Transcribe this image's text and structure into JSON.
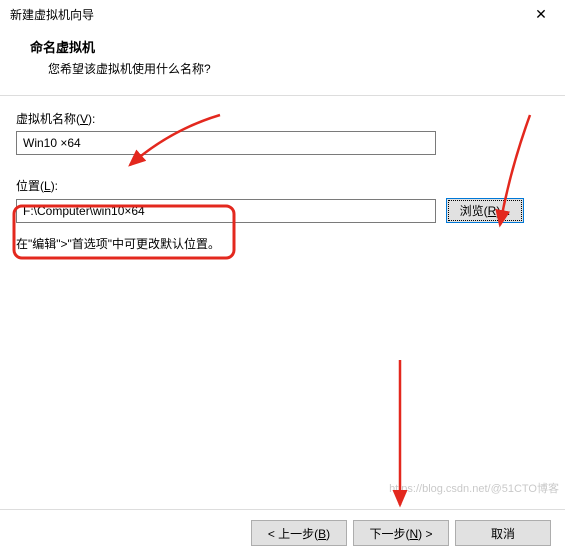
{
  "window": {
    "title": "新建虚拟机向导",
    "close_icon_title": "关闭"
  },
  "header": {
    "title": "命名虚拟机",
    "subtitle": "您希望该虚拟机使用什么名称?"
  },
  "fields": {
    "name_label_prefix": "虚拟机名称(",
    "name_label_key": "V",
    "name_label_suffix": "):",
    "name_value": "Win10 ×64",
    "location_label_prefix": "位置(",
    "location_label_key": "L",
    "location_label_suffix": "):",
    "location_value": "F:\\Computer\\win10×64",
    "browse_prefix": "浏览(",
    "browse_key": "R",
    "browse_suffix": ")..."
  },
  "hint": "在\"编辑\">\"首选项\"中可更改默认位置。",
  "footer": {
    "back_prefix": "< 上一步(",
    "back_key": "B",
    "back_suffix": ")",
    "next_prefix": "下一步(",
    "next_key": "N",
    "next_suffix": ") >",
    "cancel": "取消"
  },
  "watermark": "https://blog.csdn.net/@51CTO博客"
}
